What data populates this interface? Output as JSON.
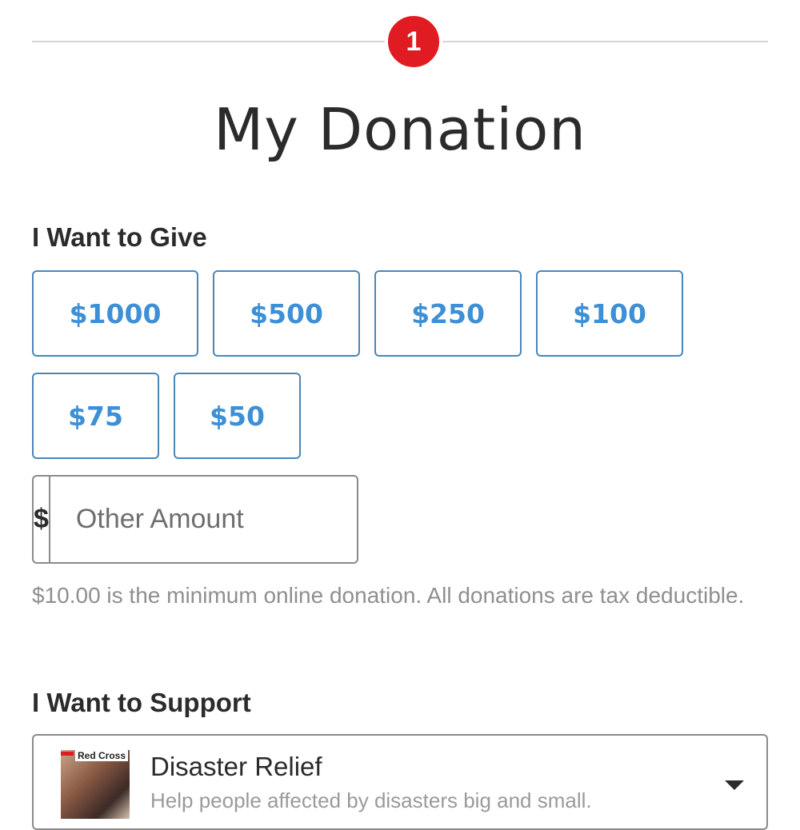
{
  "step": {
    "number": "1",
    "color": "#e11b22"
  },
  "page_title": "My Donation",
  "give": {
    "heading": "I Want to Give",
    "amounts": [
      "$1000",
      "$500",
      "$250",
      "$100",
      "$75",
      "$50"
    ],
    "accent_color": "#3d8fd6"
  },
  "other_amount": {
    "currency_symbol": "$",
    "placeholder": "Other Amount",
    "value": ""
  },
  "hint": "$10.00 is the minimum online donation.  All donations are tax deductible.",
  "support": {
    "heading": "I Want to Support",
    "selected": {
      "thumbnail_text": "Red Cross",
      "title": "Disaster Relief",
      "description": "Help people affected by disasters big and small.",
      "dropdown_icon": "caret-down-icon"
    }
  }
}
